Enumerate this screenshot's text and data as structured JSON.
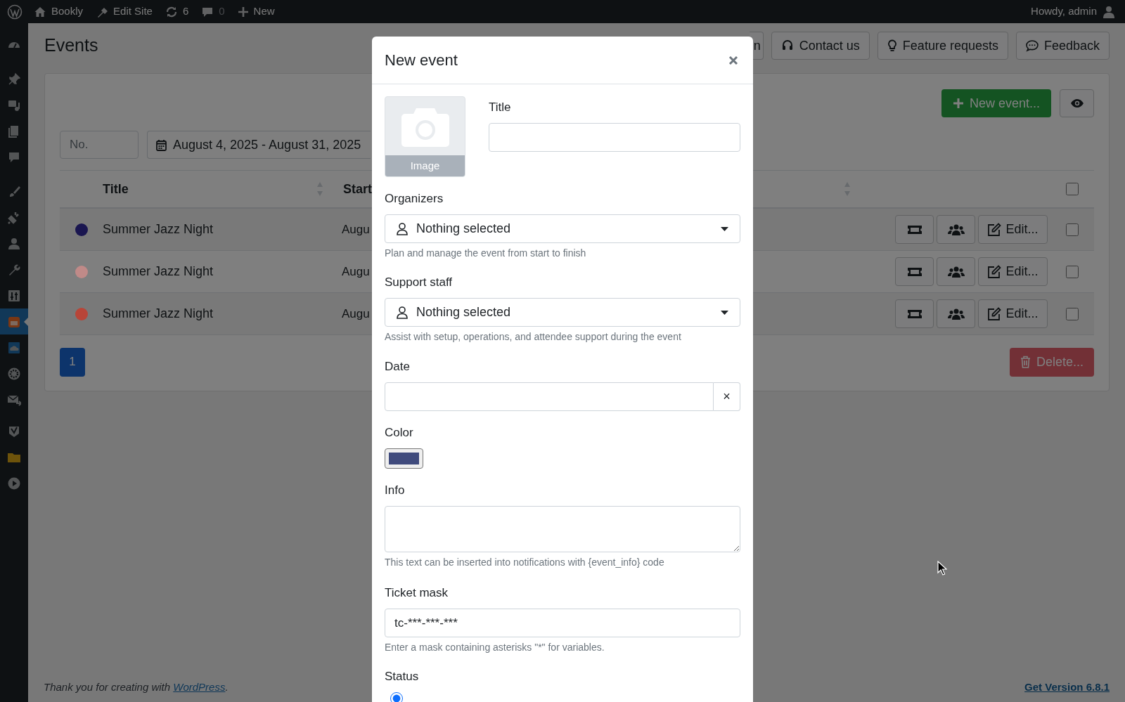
{
  "admin_bar": {
    "site": "Bookly",
    "edit_site": "Edit Site",
    "updates": "6",
    "comments": "0",
    "new": "New",
    "greeting": "Howdy, admin"
  },
  "sidebar": {
    "items": [
      {
        "selected": false
      },
      {
        "selected": false
      },
      {
        "selected": false
      },
      {
        "selected": false
      },
      {
        "selected": false
      },
      {
        "selected": false
      },
      {
        "selected": false
      },
      {
        "selected": false
      },
      {
        "selected": false
      },
      {
        "selected": false
      },
      {
        "selected": true
      },
      {
        "selected": false
      },
      {
        "selected": false
      },
      {
        "selected": false
      },
      {
        "selected": false
      },
      {
        "selected": false
      },
      {
        "selected": false
      }
    ]
  },
  "page": {
    "title": "Events",
    "header_buttons": [
      "n",
      "Contact us",
      "Feature requests",
      "Feedback"
    ]
  },
  "toolbar": {
    "new_event": "New event..."
  },
  "filters": {
    "number_placeholder": "No.",
    "date_range": "August 4, 2025 - August 31, 2025"
  },
  "table": {
    "columns": [
      "Title",
      "Start"
    ],
    "select_all_checked": false,
    "rows": [
      {
        "color": "#1a1650",
        "title": "Summer Jazz Night",
        "start": "Augu",
        "edit": "Edit...",
        "checked": false
      },
      {
        "color": "#c08a88",
        "title": "Summer Jazz Night",
        "start": "Augu",
        "edit": "Edit...",
        "checked": false
      },
      {
        "color": "#b84538",
        "title": "Summer Jazz Night",
        "start": "Augu",
        "edit": "Edit...",
        "checked": false
      }
    ]
  },
  "pagination": [
    {
      "label": "1",
      "selected": true
    }
  ],
  "delete": "Delete...",
  "footer": {
    "before": "Thank you for creating with ",
    "link": "WordPress",
    "after": ".",
    "version": "Get Version 6.8.1"
  },
  "modal": {
    "title": "New event",
    "image_label": "Image",
    "title_label": "Title",
    "organizers": {
      "label": "Organizers",
      "value": "Nothing selected",
      "help": "Plan and manage the event from start to finish"
    },
    "support_staff": {
      "label": "Support staff",
      "value": "Nothing selected",
      "help": "Assist with setup, operations, and attendee support during the event"
    },
    "date": {
      "label": "Date",
      "clear": "×"
    },
    "color": {
      "label": "Color",
      "color": "#404b7d"
    },
    "info": {
      "label": "Info",
      "help": "This text can be inserted into notifications with {event_info} code"
    },
    "ticket_mask": {
      "label": "Ticket mask",
      "value": "tc-***-***-***",
      "help": "Enter a mask containing asterisks \"*\" for variables."
    },
    "status": {
      "label": "Status",
      "options": [
        {
          "selected": true
        }
      ]
    }
  }
}
